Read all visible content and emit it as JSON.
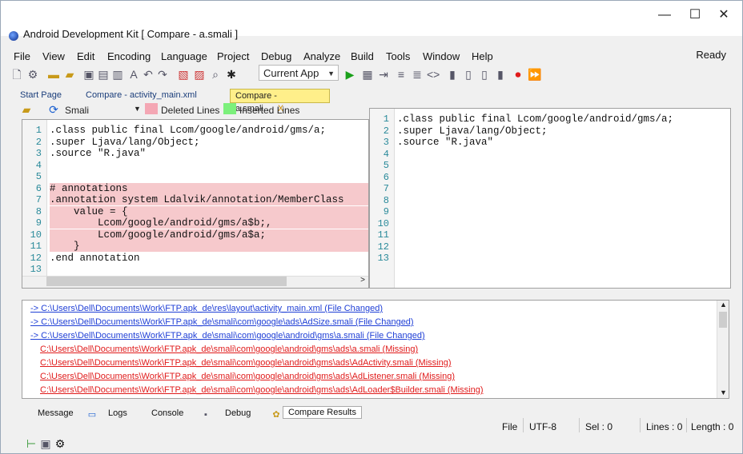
{
  "window": {
    "title": "Android Development Kit [ Compare - a.smali ]"
  },
  "menu": [
    "File",
    "View",
    "Edit",
    "Encoding",
    "Language",
    "Project",
    "Debug",
    "Analyze",
    "Build",
    "Tools",
    "Window",
    "Help"
  ],
  "status_right": "Ready",
  "toolbar": {
    "target_combo": "Current App"
  },
  "tabs": [
    "Start Page",
    "Compare - activity_main.xml",
    "Compare - a.smali"
  ],
  "compare_bar": {
    "lang": "Smali",
    "deleted_label": "Deleted Lines",
    "inserted_label": "Inserted Lines",
    "deleted_color": "#f4a7b4",
    "inserted_color": "#7cf07c"
  },
  "left_editor": {
    "lines": [
      ".class public final Lcom/google/android/gms/a;",
      ".super Ljava/lang/Object;",
      ".source \"R.java\"",
      "",
      "",
      "# annotations",
      ".annotation system Ldalvik/annotation/MemberClass",
      "    value = {",
      "        Lcom/google/android/gms/a$b;,",
      "        Lcom/google/android/gms/a$a;",
      "    }",
      ".end annotation",
      ""
    ]
  },
  "right_editor": {
    "lines": [
      ".class public final Lcom/google/android/gms/a;",
      ".super Ljava/lang/Object;",
      ".source \"R.java\"",
      "",
      "",
      "",
      "",
      "",
      "",
      "",
      "",
      "",
      ""
    ]
  },
  "output": [
    {
      "text": "-> C:\\Users\\Dell\\Documents\\Work\\FTP.apk_de\\res\\layout\\activity_main.xml  (File Changed)",
      "kind": "changed"
    },
    {
      "text": "-> C:\\Users\\Dell\\Documents\\Work\\FTP.apk_de\\smali\\com\\google\\ads\\AdSize.smali  (File Changed)",
      "kind": "changed"
    },
    {
      "text": "-> C:\\Users\\Dell\\Documents\\Work\\FTP.apk_de\\smali\\com\\google\\android\\gms\\a.smali  (File Changed)",
      "kind": "changed"
    },
    {
      "text": "C:\\Users\\Dell\\Documents\\Work\\FTP.apk_de\\smali\\com\\google\\android\\gms\\ads\\a.smali  (Missing)",
      "kind": "missing"
    },
    {
      "text": "C:\\Users\\Dell\\Documents\\Work\\FTP.apk_de\\smali\\com\\google\\android\\gms\\ads\\AdActivity.smali  (Missing)",
      "kind": "missing"
    },
    {
      "text": "C:\\Users\\Dell\\Documents\\Work\\FTP.apk_de\\smali\\com\\google\\android\\gms\\ads\\AdListener.smali  (Missing)",
      "kind": "missing"
    },
    {
      "text": "C:\\Users\\Dell\\Documents\\Work\\FTP.apk_de\\smali\\com\\google\\android\\gms\\ads\\AdLoader$Builder.smali  (Missing)",
      "kind": "missing"
    }
  ],
  "bottom_tabs": [
    "Message",
    "Logs",
    "Console",
    "Debug",
    "Compare Results"
  ],
  "status": {
    "file_label": "File",
    "encoding": "UTF-8",
    "sel": "Sel : 0",
    "lines": "Lines : 0",
    "length": "Length : 0"
  }
}
